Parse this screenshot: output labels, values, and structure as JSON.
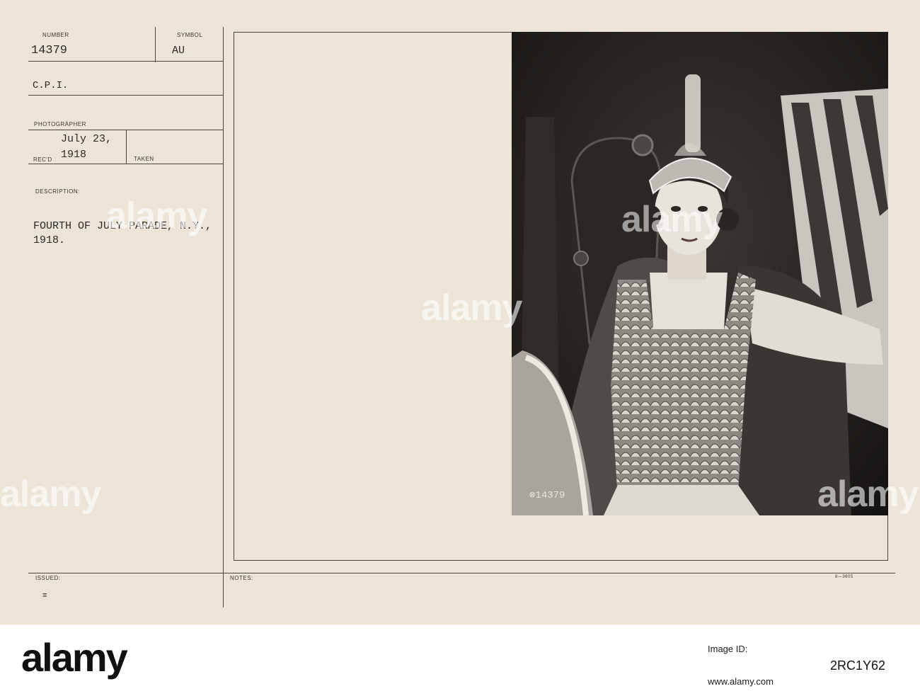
{
  "card": {
    "number_label": "NUMBER",
    "number_value": "14379",
    "symbol_label": "SYMBOL",
    "symbol_value": "AU",
    "agency": "C.P.I.",
    "photographer_label": "PHOTOGRAPHER",
    "recd_label": "REC'D",
    "recd_date_line1": "July 23,",
    "recd_date_line2": "1918",
    "taken_label": "TAKEN",
    "description_label": "DESCRIPTION:",
    "description_line1": "FOURTH OF JULY PARADE, N.Y.,",
    "description_line2": "1918.",
    "issued_label": "ISSUED:",
    "notes_label": "NOTES:",
    "form_number": "8—3605",
    "photo_caption": "⊗14379"
  },
  "watermark": {
    "text": "alamy",
    "small": "a"
  },
  "footer": {
    "logo": "alamy",
    "image_id_label": "Image ID:",
    "image_id": "2RC1Y62",
    "site": "www.alamy.com"
  },
  "colors": {
    "paper": "#ece5d7",
    "ink": "#2c2a27",
    "photo_dark": "#1d1b19"
  }
}
